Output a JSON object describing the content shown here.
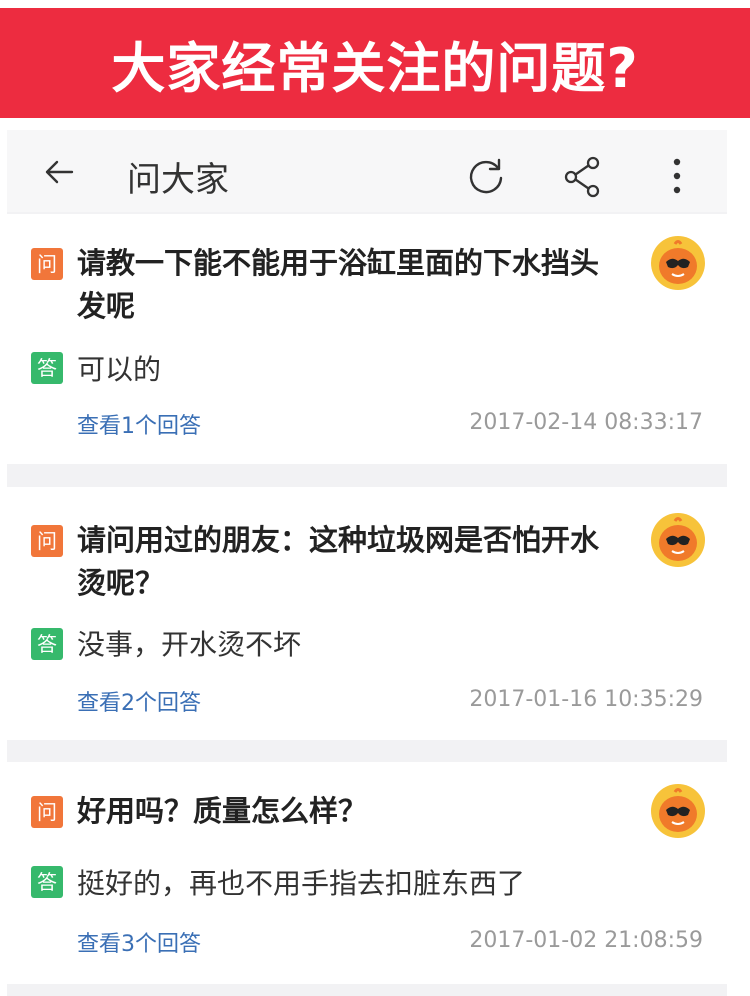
{
  "banner": {
    "title": "大家经常关注的问题?"
  },
  "topbar": {
    "title": "问大家"
  },
  "badges": {
    "question": "问",
    "answer": "答"
  },
  "questions": [
    {
      "question": "请教一下能不能用于浴缸里面的下水挡头发呢",
      "answer": "可以的",
      "link": "查看1个回答",
      "time": "2017-02-14 08:33:17"
    },
    {
      "question": "请问用过的朋友：这种垃圾网是否怕开水烫呢？",
      "answer": "没事，开水烫不坏",
      "link": "查看2个回答",
      "time": "2017-01-16 10:35:29"
    },
    {
      "question": "好用吗？质量怎么样？",
      "answer": "挺好的，再也不用手指去扣脏东西了",
      "link": "查看3个回答",
      "time": "2017-01-02 21:08:59"
    }
  ],
  "colors": {
    "banner": "#ed2c40",
    "question_badge": "#f1763a",
    "answer_badge": "#36b96c",
    "link": "#3a6fb5",
    "timestamp": "#9a9a9a"
  }
}
